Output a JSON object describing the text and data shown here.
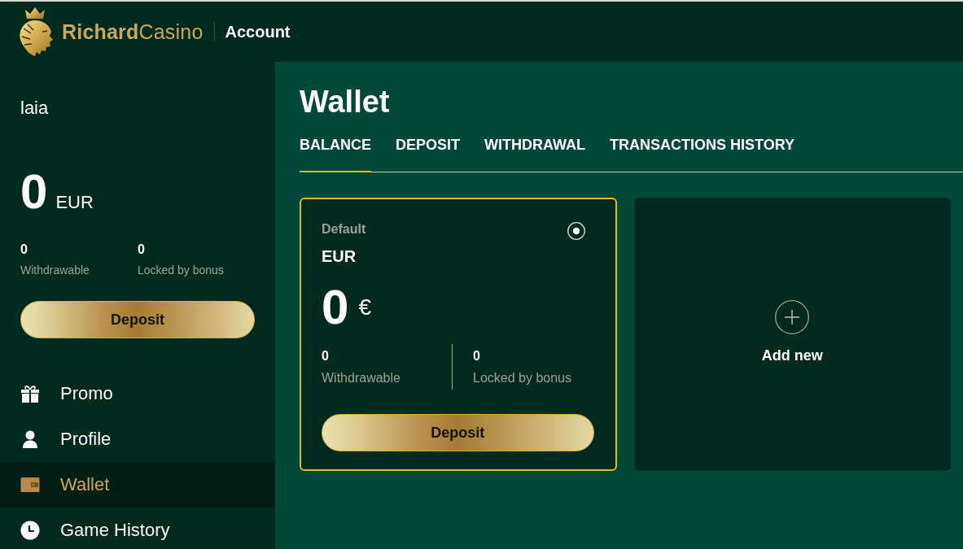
{
  "header": {
    "brand": "**Richard**Casino",
    "section": "Account"
  },
  "sidebar": {
    "username": "laia",
    "balance": {
      "amount": "0",
      "currency": "EUR"
    },
    "stats": [
      {
        "value": "0",
        "label": "Withdrawable"
      },
      {
        "value": "0",
        "label": "Locked by bonus"
      }
    ],
    "deposit_button": "Deposit",
    "nav": [
      {
        "label": "Promo",
        "selected": false
      },
      {
        "label": "Profile",
        "selected": false
      },
      {
        "label": "Wallet",
        "selected": true
      },
      {
        "label": "Game History",
        "selected": false
      }
    ]
  },
  "main": {
    "title": "Wallet",
    "tabs": [
      {
        "label": "BALANCE",
        "selected": true
      },
      {
        "label": "DEPOSIT",
        "selected": false
      },
      {
        "label": "WITHDRAWAL",
        "selected": false
      },
      {
        "label": "TRANSACTIONS HISTORY",
        "selected": false
      }
    ],
    "cards": [
      {
        "kind": "wallet",
        "tag": "Default",
        "currency": "EUR",
        "selected": true,
        "amount": "0",
        "symbol": "€",
        "stats": [
          {
            "value": "0",
            "label": "Withdrawable"
          },
          {
            "value": "0",
            "label": "Locked by bonus"
          }
        ],
        "button": "Deposit"
      },
      {
        "kind": "add",
        "label": "Add new"
      }
    ]
  }
}
